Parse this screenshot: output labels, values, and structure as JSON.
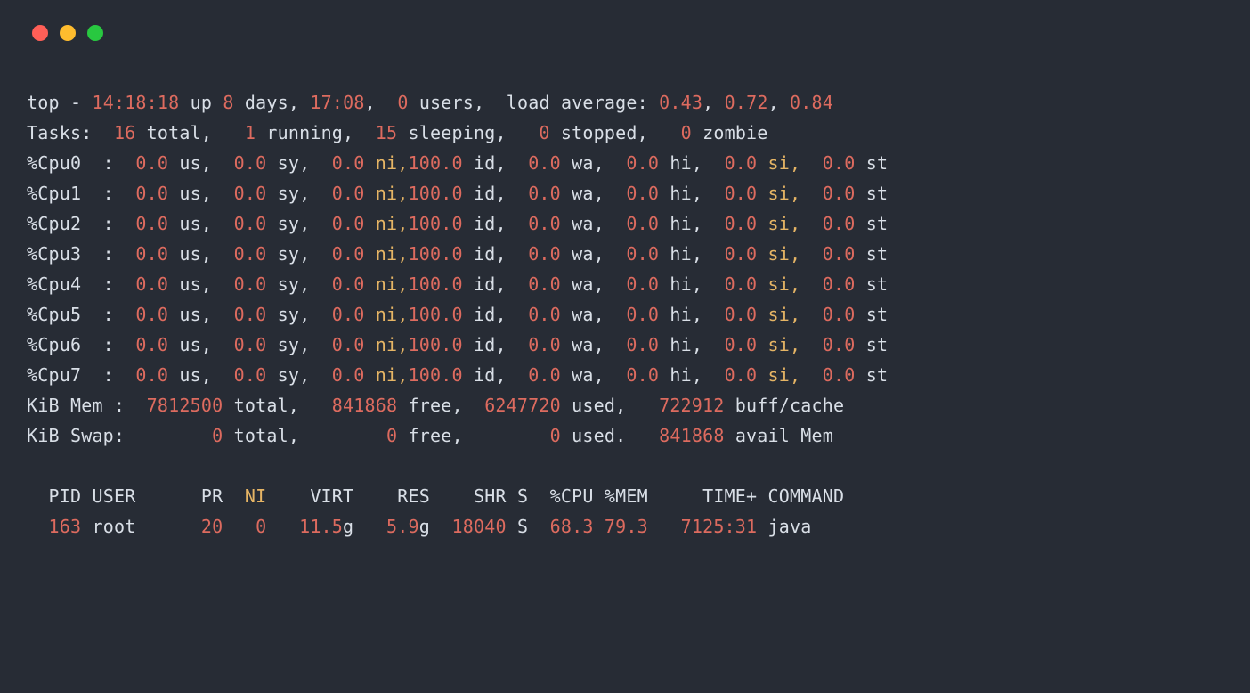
{
  "summary": {
    "program": "top",
    "time": "14:18:18",
    "uptime_days": "8",
    "uptime_hm": "17:08",
    "users": "0",
    "load1": "0.43",
    "load2": "0.72",
    "load3": "0.84"
  },
  "tasks": {
    "total": "16",
    "running": "1",
    "sleeping": "15",
    "stopped": "0",
    "zombie": "0"
  },
  "cpus": [
    {
      "label": "%Cpu0",
      "us": "0.0",
      "sy": "0.0",
      "ni": "0.0",
      "id": "100.0",
      "wa": "0.0",
      "hi": "0.0",
      "si": "0.0",
      "st": "0.0"
    },
    {
      "label": "%Cpu1",
      "us": "0.0",
      "sy": "0.0",
      "ni": "0.0",
      "id": "100.0",
      "wa": "0.0",
      "hi": "0.0",
      "si": "0.0",
      "st": "0.0"
    },
    {
      "label": "%Cpu2",
      "us": "0.0",
      "sy": "0.0",
      "ni": "0.0",
      "id": "100.0",
      "wa": "0.0",
      "hi": "0.0",
      "si": "0.0",
      "st": "0.0"
    },
    {
      "label": "%Cpu3",
      "us": "0.0",
      "sy": "0.0",
      "ni": "0.0",
      "id": "100.0",
      "wa": "0.0",
      "hi": "0.0",
      "si": "0.0",
      "st": "0.0"
    },
    {
      "label": "%Cpu4",
      "us": "0.0",
      "sy": "0.0",
      "ni": "0.0",
      "id": "100.0",
      "wa": "0.0",
      "hi": "0.0",
      "si": "0.0",
      "st": "0.0"
    },
    {
      "label": "%Cpu5",
      "us": "0.0",
      "sy": "0.0",
      "ni": "0.0",
      "id": "100.0",
      "wa": "0.0",
      "hi": "0.0",
      "si": "0.0",
      "st": "0.0"
    },
    {
      "label": "%Cpu6",
      "us": "0.0",
      "sy": "0.0",
      "ni": "0.0",
      "id": "100.0",
      "wa": "0.0",
      "hi": "0.0",
      "si": "0.0",
      "st": "0.0"
    },
    {
      "label": "%Cpu7",
      "us": "0.0",
      "sy": "0.0",
      "ni": "0.0",
      "id": "100.0",
      "wa": "0.0",
      "hi": "0.0",
      "si": "0.0",
      "st": "0.0"
    }
  ],
  "mem": {
    "label": "KiB Mem :",
    "total": "7812500",
    "free": "841868",
    "used": "6247720",
    "buff": "722912"
  },
  "swap": {
    "label": "KiB Swap:",
    "total": "0",
    "free": "0",
    "used": "0",
    "avail": "841868"
  },
  "header": {
    "pid": "PID",
    "user": "USER",
    "pr": "PR",
    "ni": "NI",
    "virt": "VIRT",
    "res": "RES",
    "shr": "SHR",
    "s": "S",
    "cpu": "%CPU",
    "mem": "%MEM",
    "time": "TIME+",
    "cmd": "COMMAND"
  },
  "rows": [
    {
      "pid": "163",
      "user": "root",
      "pr": "20",
      "ni": "0",
      "virt": "11.5",
      "virt_unit": "g",
      "res": "5.9",
      "res_unit": "g",
      "shr": "18040",
      "s": "S",
      "cpu": "68.3",
      "mem": "79.3",
      "time": "7125:31",
      "cmd": "java"
    }
  ],
  "labels": {
    "up": "up",
    "days": "days,",
    "users_lbl": "users,",
    "load_lbl": "load average:",
    "tasks": "Tasks:",
    "total": "total,",
    "running": "running,",
    "sleeping": "sleeping,",
    "stopped": "stopped,",
    "zombie": "zombie",
    "us": "us,",
    "sy": "sy,",
    "ni": "ni,",
    "id": "id,",
    "wa": "wa,",
    "hi": "hi,",
    "si": "si,",
    "st": "st",
    "mem_total": "total,",
    "mem_free": "free,",
    "mem_used": "used,",
    "mem_buff": "buff/cache",
    "swap_used": "used.",
    "swap_avail": "avail Mem"
  }
}
